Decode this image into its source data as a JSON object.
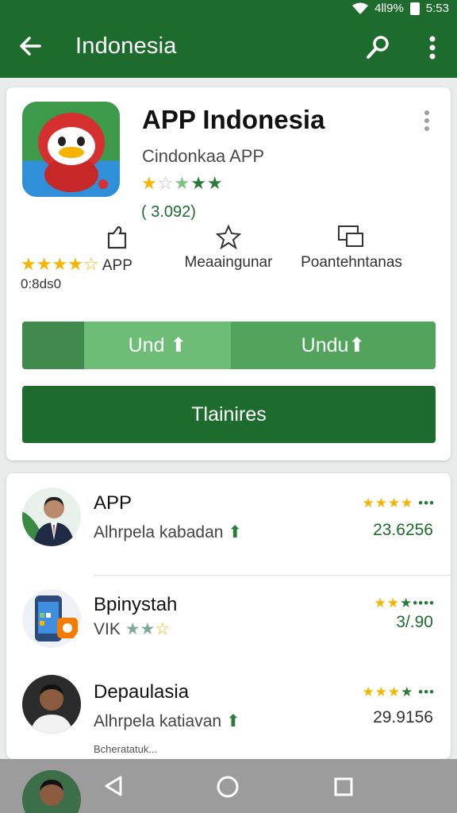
{
  "status_bar": {
    "battery": "4ll9%",
    "time": "5:53"
  },
  "toolbar": {
    "title": "Indonesia"
  },
  "app": {
    "title": "APP Indonesia",
    "developer": "Cindonkaa APP",
    "count": "( 3.092)"
  },
  "meta": {
    "rating_label": "APP",
    "rating_sub": "0:8ds0",
    "second_label": "Meaaingunar",
    "third_label": "Poantehntanas"
  },
  "buttons": {
    "split_left": "Und ⬆",
    "split_right": "Undu⬆",
    "main": "Tlainires"
  },
  "list": [
    {
      "name": "APP",
      "sub": "Alhrpela kabadan",
      "value": "23.6256"
    },
    {
      "name": "Bpinystah",
      "sub": "VIK",
      "value": "3/.90"
    },
    {
      "name": "Depaulasia",
      "sub": "Alhrpela katiavan",
      "value": "29.9156"
    }
  ],
  "list_footer": "Bcheratatuk...",
  "colors": {
    "primary": "#1e6b2e",
    "accent": "#f4b400"
  }
}
